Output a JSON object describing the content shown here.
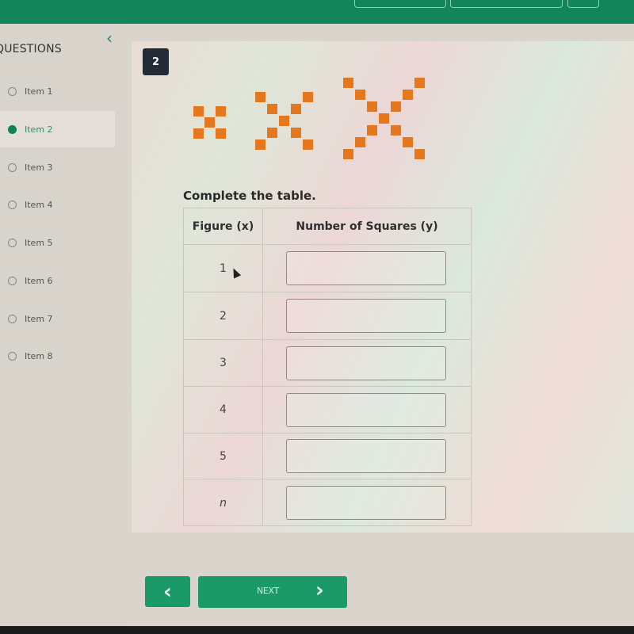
{
  "header": {
    "buttons": [
      "",
      "",
      ""
    ]
  },
  "sidebar": {
    "title": "QUESTIONS",
    "collapse_icon": "chevron-left-icon",
    "collapse_glyph": "‹",
    "items": [
      {
        "label": "Item 1",
        "state": "unanswered"
      },
      {
        "label": "Item 2",
        "state": "current"
      },
      {
        "label": "Item 3",
        "state": "unanswered"
      },
      {
        "label": "Item 4",
        "state": "unanswered"
      },
      {
        "label": "Item 5",
        "state": "unanswered"
      },
      {
        "label": "Item 6",
        "state": "unanswered"
      },
      {
        "label": "Item 7",
        "state": "unanswered"
      },
      {
        "label": "Item 8",
        "state": "unanswered"
      }
    ]
  },
  "question": {
    "number": "2",
    "figures": [
      {
        "figure": 1,
        "squares": 5
      },
      {
        "figure": 2,
        "squares": 9
      },
      {
        "figure": 3,
        "squares": 13
      }
    ],
    "square_color": "#e5781f",
    "prompt": "Complete the table.",
    "table": {
      "headers": [
        "Figure (x)",
        "Number of Squares (y)"
      ],
      "rows": [
        {
          "x": "1",
          "y": ""
        },
        {
          "x": "2",
          "y": ""
        },
        {
          "x": "3",
          "y": ""
        },
        {
          "x": "4",
          "y": ""
        },
        {
          "x": "5",
          "y": ""
        },
        {
          "x": "n",
          "y": ""
        }
      ]
    }
  },
  "nav": {
    "prev_glyph": "‹",
    "next_label": "NEXT",
    "next_glyph": "›",
    "accent": "#1a9a68"
  }
}
